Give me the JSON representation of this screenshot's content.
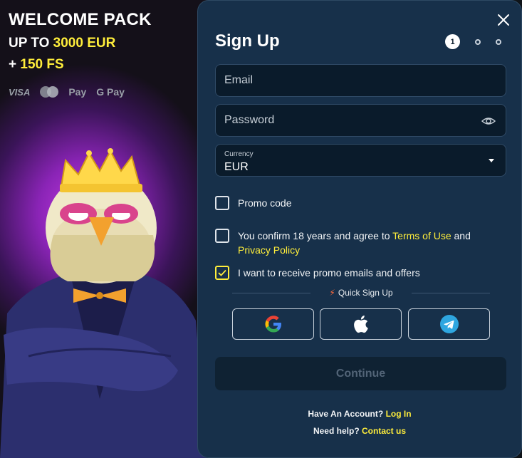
{
  "promo": {
    "title": "WELCOME PACK",
    "line1_prefix": "UP TO",
    "line1_amount": "3000 EUR",
    "line2_plus": "+",
    "line2_amount": "150 FS",
    "payments": [
      "VISA",
      "mastercard",
      "Pay",
      "Pay"
    ]
  },
  "form": {
    "title": "Sign Up",
    "steps": {
      "current": "1",
      "total": 3
    },
    "email_placeholder": "Email",
    "password_placeholder": "Password",
    "currency_label": "Currency",
    "currency_value": "EUR",
    "promo_code_label": "Promo code",
    "confirm_text": "You confirm 18 years and agree to",
    "terms_link": "Terms of Use",
    "and_text": "and",
    "privacy_link": "Privacy Policy",
    "emails_label": "I want to receive promo emails and offers",
    "emails_checked": true,
    "quick_signup_label": "Quick Sign Up",
    "continue_label": "Continue",
    "account_text": "Have An Account?",
    "login_link": "Log In",
    "help_text": "Need help?",
    "contact_link": "Contact us"
  },
  "colors": {
    "accent": "#ffee3b",
    "modal_bg": "#17304a",
    "field_bg": "#0a1b2b",
    "telegram": "#2ea6e0"
  }
}
